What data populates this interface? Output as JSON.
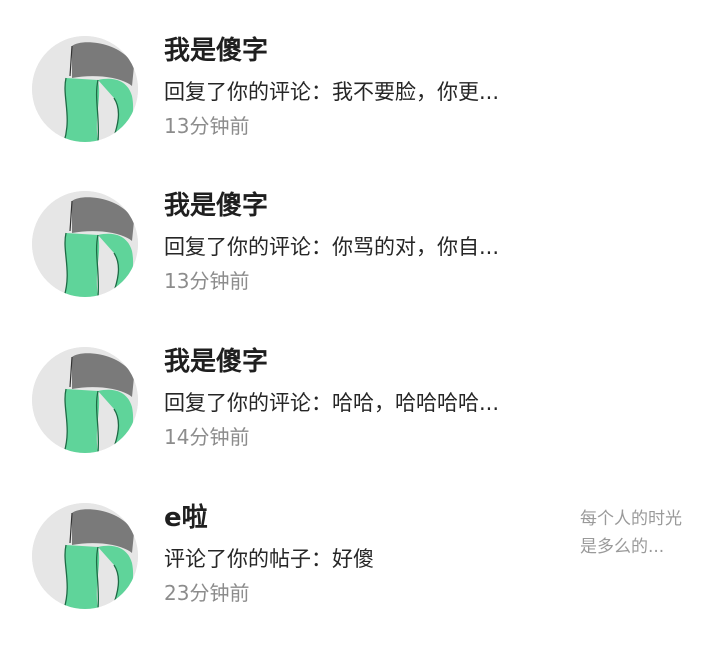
{
  "notifications": [
    {
      "user": "我是傻字",
      "content": "回复了你的评论：我不要脸，你更...",
      "time": "13分钟前",
      "avatar_icon": "avatar-legs-figure-icon"
    },
    {
      "user": "我是傻字",
      "content": "回复了你的评论：你骂的对，你自...",
      "time": "13分钟前",
      "avatar_icon": "avatar-legs-figure-icon"
    },
    {
      "user": "我是傻字",
      "content": "回复了你的评论：哈哈，哈哈哈哈...",
      "time": "14分钟前",
      "avatar_icon": "avatar-legs-figure-icon"
    },
    {
      "user": "e啦",
      "content": "评论了你的帖子：好傻",
      "time": "23分钟前",
      "avatar_icon": "avatar-legs-figure-icon",
      "post_preview": "每个人的时光是多么的..."
    }
  ],
  "colors": {
    "name": "#1f1f1f",
    "content": "#262626",
    "time": "#8c8c8c",
    "preview": "#9a9a9a",
    "avatar_bg": "#e6e6e6",
    "avatar_green": "#5fd49a"
  }
}
